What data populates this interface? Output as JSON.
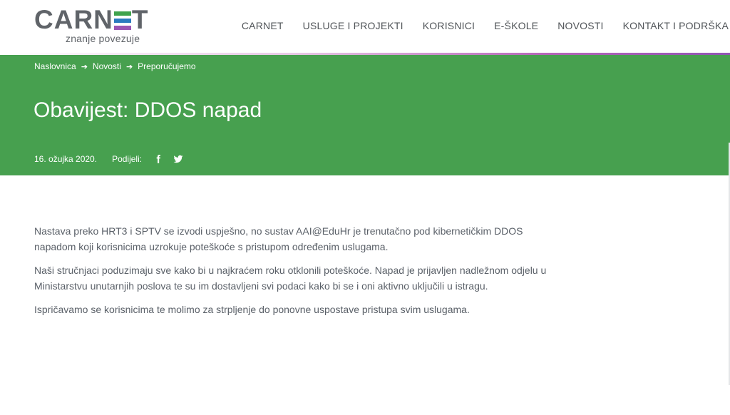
{
  "brand": {
    "word_left": "CARN",
    "word_right": "T",
    "tagline": "znanje povezuje",
    "stripe_colors": [
      "#3fa34d",
      "#2b7bbf",
      "#9b55b3",
      "#e6a12f"
    ]
  },
  "nav": {
    "items": [
      "CARNET",
      "USLUGE I PROJEKTI",
      "KORISNICI",
      "E-ŠKOLE",
      "NOVOSTI",
      "KONTAKT I PODRŠKA"
    ]
  },
  "breadcrumb": {
    "items": [
      "Naslovnica",
      "Novosti",
      "Preporučujemo"
    ],
    "separator": "➔"
  },
  "article": {
    "title": "Obavijest: DDOS napad",
    "date": "16. ožujka 2020.",
    "share_label": "Podijeli:",
    "share_icons": [
      "facebook-icon",
      "twitter-icon"
    ],
    "paragraphs": [
      "Nastava preko HRT3 i SPTV se izvodi uspješno, no sustav AAI@EduHr je trenutačno pod kibernetičkim DDOS napadom koji korisnicima uzrokuje poteškoće s pristupom određenim uslugama.",
      "Naši stručnjaci poduzimaju sve kako bi u najkraćem roku otklonili poteškoće. Napad je prijavljen nadležnom odjelu u Ministarstvu unutarnjih poslova te su im dostavljeni svi podaci kako bi se i oni aktivno uključili u istragu.",
      "Ispričavamo se korisnicima te molimo za strpljenje do ponovne uspostave pristupa svim uslugama."
    ]
  },
  "colors": {
    "hero_green": "#47a04f",
    "text_gray": "#5a6068",
    "accent_purple": "#9055b4"
  }
}
